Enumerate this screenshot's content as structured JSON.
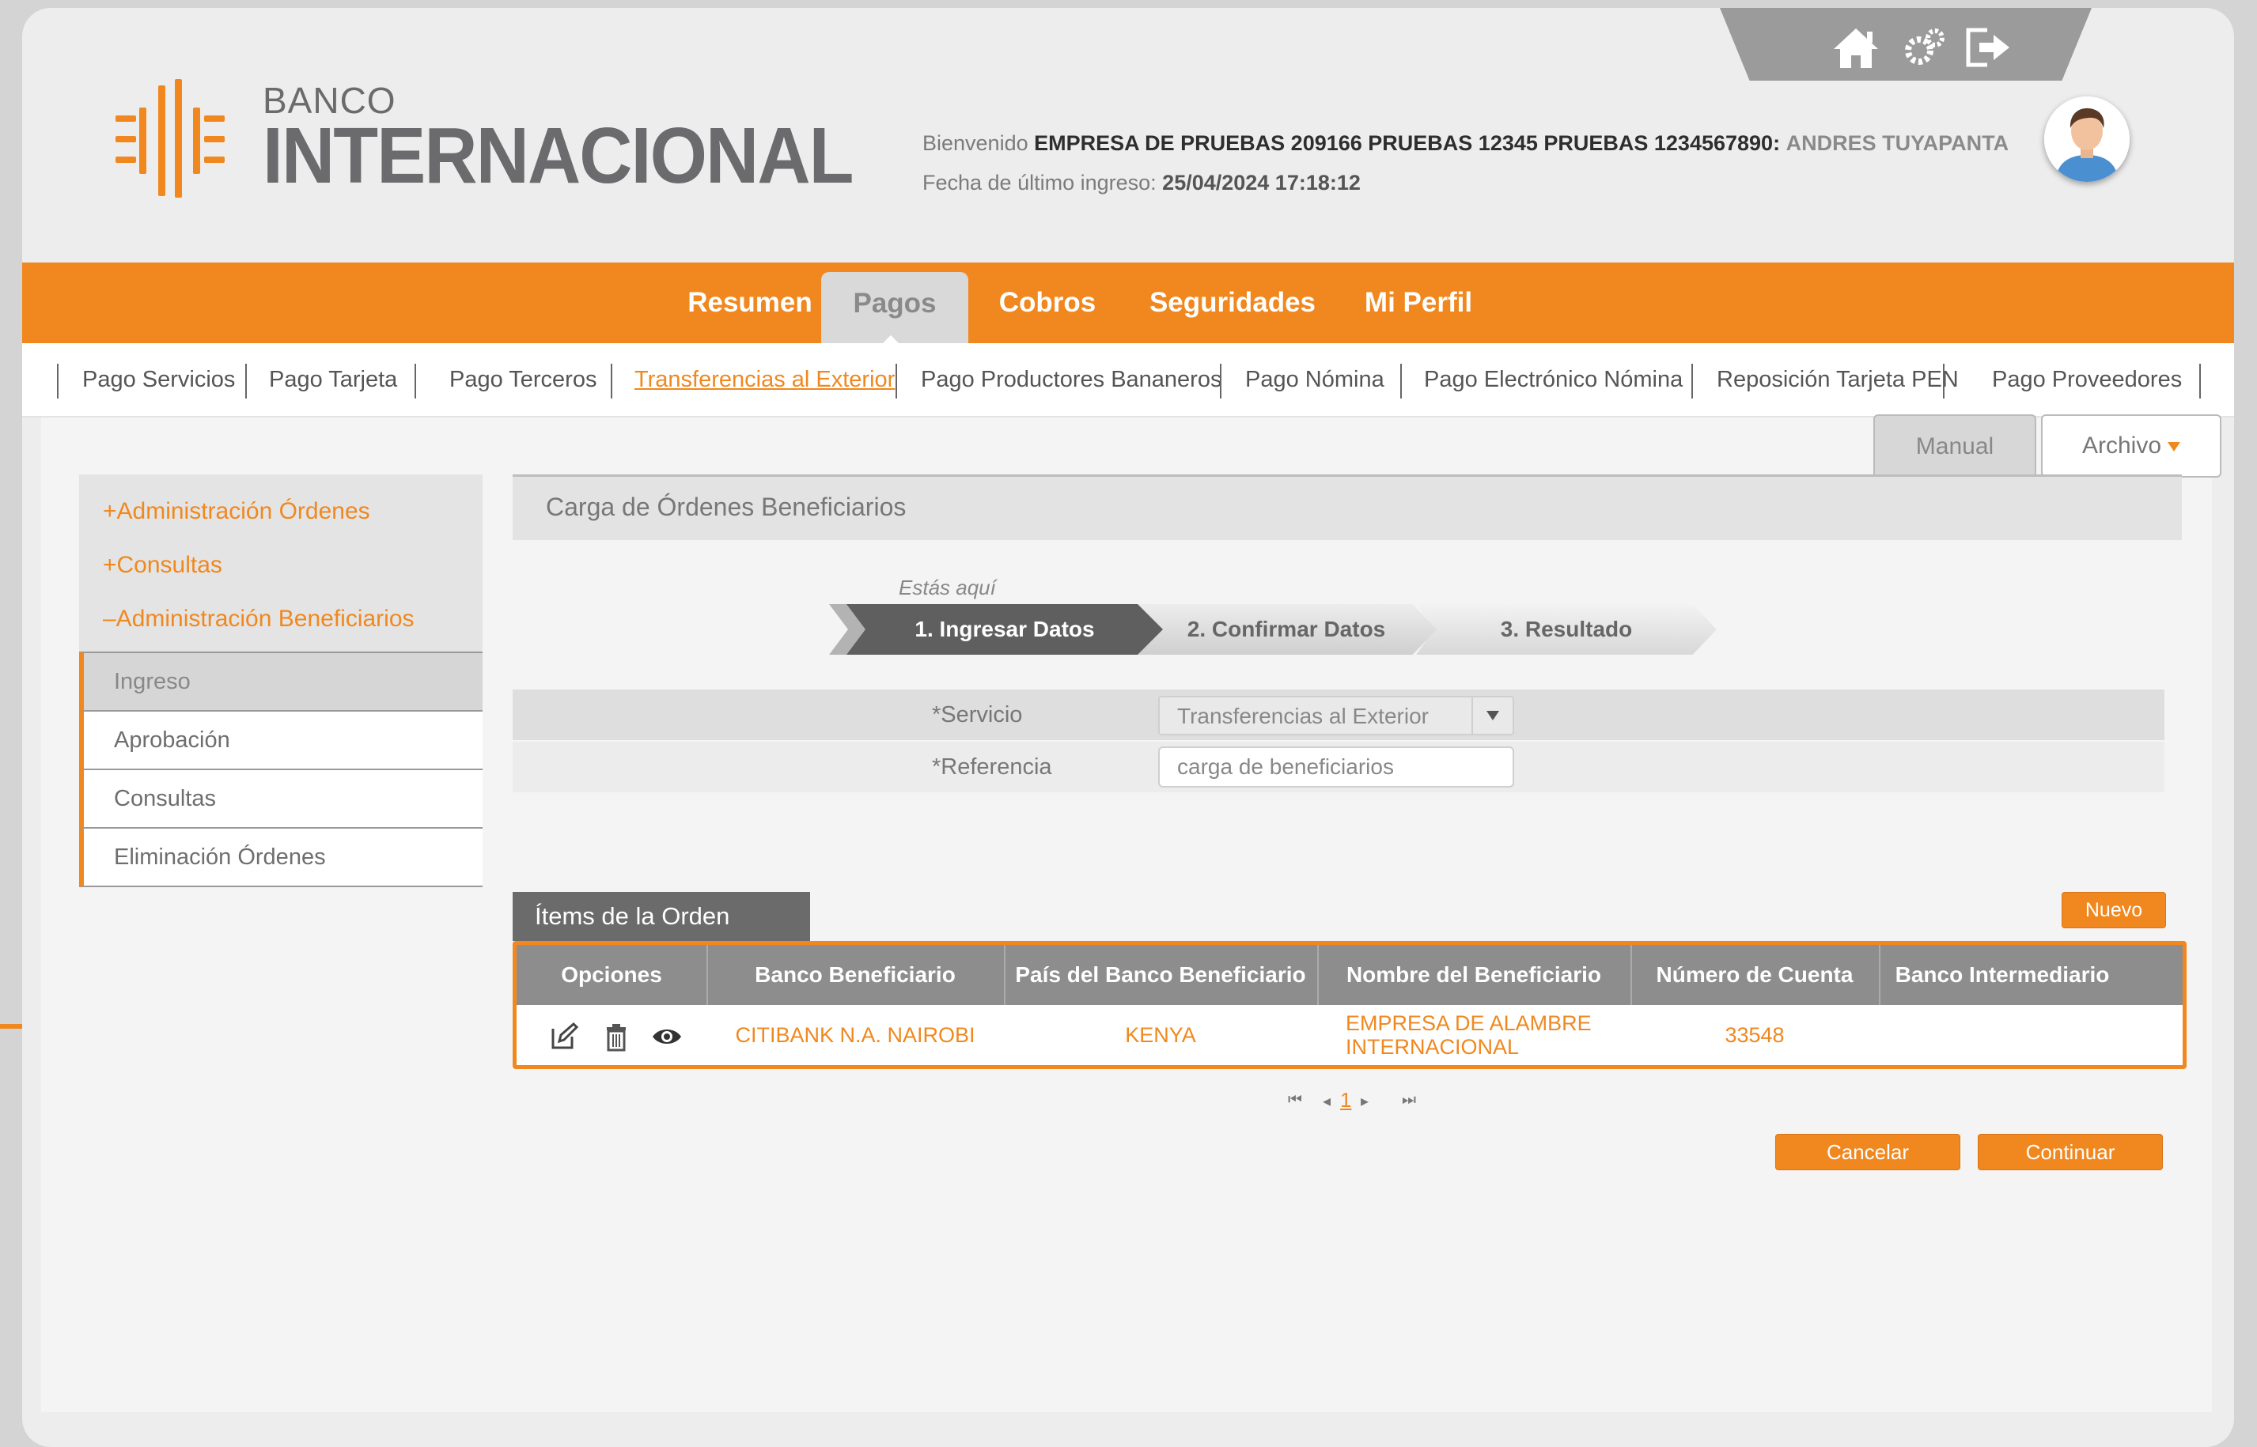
{
  "brand": {
    "small": "BANCO",
    "big": "INTERNACIONAL",
    "color": "#f0881f"
  },
  "header": {
    "icons": [
      "home-icon",
      "settings-icon",
      "logout-icon"
    ],
    "welcome_prefix": "Bienvenido",
    "company": "EMPRESA DE PRUEBAS 209166 PRUEBAS 12345 PRUEBAS 1234567890:",
    "user": "ANDRES TUYAPANTA",
    "last_login_label": "Fecha de último ingreso:",
    "last_login_value": "25/04/2024 17:18:12"
  },
  "main_nav": [
    "Resumen",
    "Pagos",
    "Cobros",
    "Seguridades",
    "Mi Perfil"
  ],
  "main_nav_active": "Pagos",
  "sub_nav": [
    "Pago Servicios",
    "Pago Tarjeta",
    "Pago Terceros",
    "Transferencias al Exterior",
    "Pago Productores Bananeros",
    "Pago Nómina",
    "Pago Electrónico Nómina",
    "Reposición Tarjeta PEN",
    "Pago Proveedores"
  ],
  "sub_nav_active": "Transferencias al Exterior",
  "mode_tabs": {
    "manual": "Manual",
    "archivo": "Archivo"
  },
  "side_menu": {
    "sections": [
      "+Administración Órdenes",
      "+Consultas",
      "–Administración Beneficiarios"
    ],
    "items": [
      "Ingreso",
      "Aprobación",
      "Consultas",
      "Eliminación Órdenes"
    ],
    "selected": "Ingreso"
  },
  "panel": {
    "title": "Carga de Órdenes Beneficiarios",
    "you_are_here": "Estás aquí",
    "steps": [
      "1. Ingresar Datos",
      "2. Confirmar Datos",
      "3. Resultado"
    ],
    "current_step": 1
  },
  "form": {
    "servicio_label": "*Servicio",
    "servicio_value": "Transferencias al Exterior",
    "referencia_label": "*Referencia",
    "referencia_value": "carga de beneficiarios"
  },
  "items": {
    "tab_label": "Ítems de la Orden",
    "new_button": "Nuevo",
    "columns": [
      "Opciones",
      "Banco Beneficiario",
      "País del Banco Beneficiario",
      "Nombre del Beneficiario",
      "Número de Cuenta",
      "Banco Intermediario"
    ],
    "rows": [
      {
        "options": [
          "edit-icon",
          "trash-icon",
          "view-icon"
        ],
        "banco": "CITIBANK N.A. NAIROBI",
        "pais": "KENYA",
        "nombre_line1": "EMPRESA DE ALAMBRE",
        "nombre_line2": "INTERNACIONAL",
        "cuenta": "33548",
        "intermediario": ""
      }
    ]
  },
  "pagination": {
    "current": "1"
  },
  "actions": {
    "cancel": "Cancelar",
    "continue": "Continuar"
  }
}
